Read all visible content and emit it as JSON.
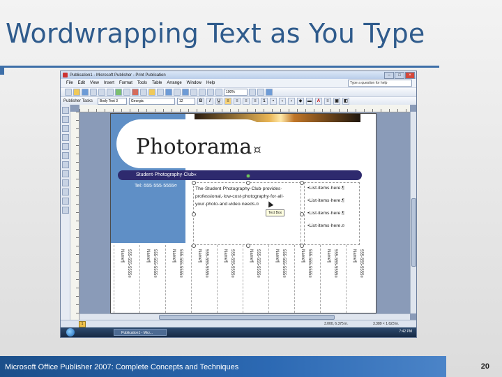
{
  "slide": {
    "title": "Wordwrapping Text as You Type",
    "footer": "Microsoft Office Publisher 2007: Complete Concepts and Techniques",
    "page_number": "20"
  },
  "window": {
    "title": "Publication1 - Microsoft Publisher - Print Publication",
    "menu": [
      "File",
      "Edit",
      "View",
      "Insert",
      "Format",
      "Tools",
      "Table",
      "Arrange",
      "Window",
      "Help"
    ],
    "help_placeholder": "Type a question for help",
    "zoom": "100%",
    "publisher_tasks": "Publisher Tasks",
    "style": "Body Text 3",
    "font": "Georgia",
    "size": "12"
  },
  "publication": {
    "logo": "Photorama",
    "logo_mark": "¤",
    "band_text": "Student·Photography·Club«",
    "phone": "Tel:·555·555·5555¤",
    "body_lines": [
      "The·Student·Photography·Club·provides·",
      "professional,·low-cost·photography·for·all·",
      "your·photo·and·video·needs.¤"
    ],
    "tooltip": "Text Box",
    "list_items": [
      "•List·items·here.¶",
      "•List·items·here.¶",
      "•List·items·here.¶",
      "•List·items·here.¤"
    ],
    "tear_name": "Name¶",
    "tear_phone": "555-555-5555¤"
  },
  "status": {
    "page": "1",
    "position": "3.000, 6.375 in.",
    "size": "3.389 × 1.623 in."
  },
  "taskbar": {
    "item": "Publication1 - Micr...",
    "clock": "7:42 PM"
  },
  "colors": {
    "title": "#2f5b8c",
    "footer": "#2c69b3",
    "band": "#2e2a6e",
    "page_blue": "#5f8fc6"
  }
}
